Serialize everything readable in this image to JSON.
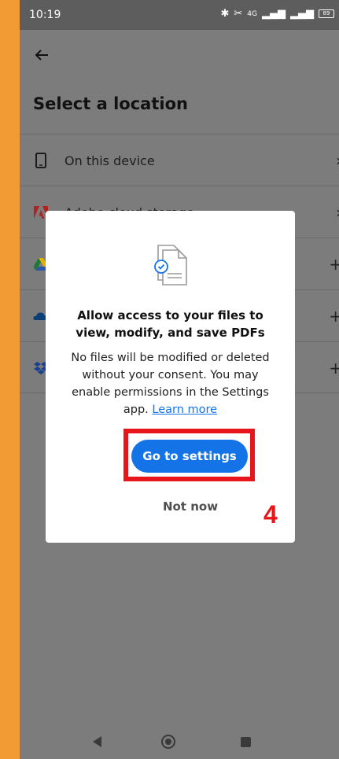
{
  "status_bar": {
    "time": "10:19",
    "signal_text": "4G",
    "battery": "89"
  },
  "page": {
    "title": "Select a location",
    "locations": [
      {
        "label": "On this device",
        "icon": "phone-icon",
        "trail": "›"
      },
      {
        "label": "Adobe cloud storage",
        "icon": "adobe-icon",
        "trail": "›"
      },
      {
        "label": "",
        "icon": "google-drive-icon",
        "trail": "+"
      },
      {
        "label": "",
        "icon": "onedrive-icon",
        "trail": "+"
      },
      {
        "label": "",
        "icon": "dropbox-icon",
        "trail": "+"
      }
    ]
  },
  "dialog": {
    "heading": "Allow access to your files to view, modify, and save PDFs",
    "body": "No files will be modified or deleted without your consent. You may enable permissions in the Settings app.",
    "learn_more": "Learn more",
    "primary_button": "Go to settings",
    "secondary_button": "Not now"
  },
  "annotation": {
    "step_number": "4",
    "color": "#e8151b"
  },
  "colors": {
    "accent": "#1473e6",
    "background": "#f29a33"
  }
}
